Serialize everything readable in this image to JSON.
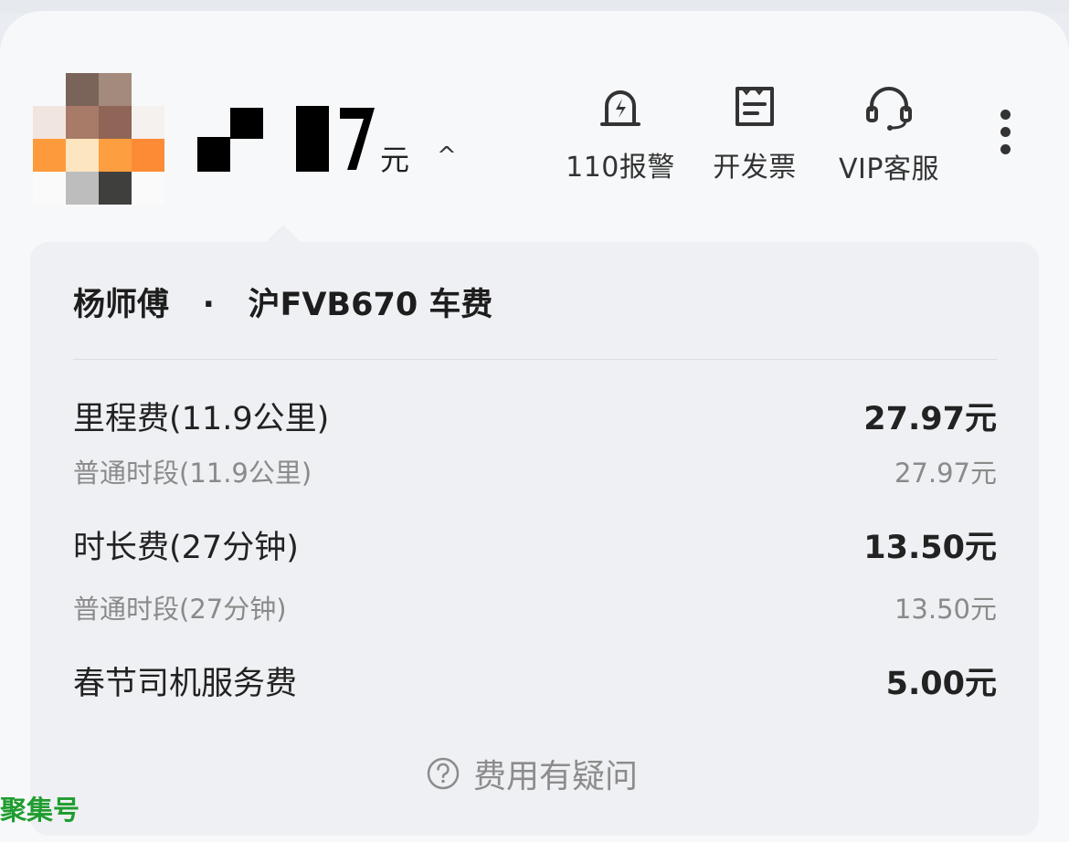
{
  "amount": {
    "unit": "元",
    "toggle_icon": "chevron-up-icon"
  },
  "actions": [
    {
      "label": "110报警",
      "icon": "alarm-icon"
    },
    {
      "label": "开发票",
      "icon": "receipt-icon"
    },
    {
      "label": "VIP客服",
      "icon": "headset-icon"
    }
  ],
  "more_icon": "more-vertical-icon",
  "trip": {
    "driver": "杨师傅",
    "separator": "·",
    "plate_fee": "沪FVB670 车费"
  },
  "fees": [
    {
      "label": "里程费(11.9公里)",
      "value": "27.97元",
      "level": "main"
    },
    {
      "label": "普通时段(11.9公里)",
      "value": "27.97元",
      "level": "sub"
    },
    {
      "label": "时长费(27分钟)",
      "value": "13.50元",
      "level": "main"
    },
    {
      "label": "普通时段(27分钟)",
      "value": "13.50元",
      "level": "sub"
    },
    {
      "label": "春节司机服务费",
      "value": "5.00元",
      "level": "main"
    }
  ],
  "question": {
    "icon": "help-circle-icon",
    "label": "费用有疑问"
  },
  "watermark": "聚集号",
  "colors": {
    "background": "#f7f8fa",
    "card": "#eff0f3",
    "text": "#222222",
    "muted": "#8a8a8a",
    "watermark": "#1f9d2f"
  }
}
